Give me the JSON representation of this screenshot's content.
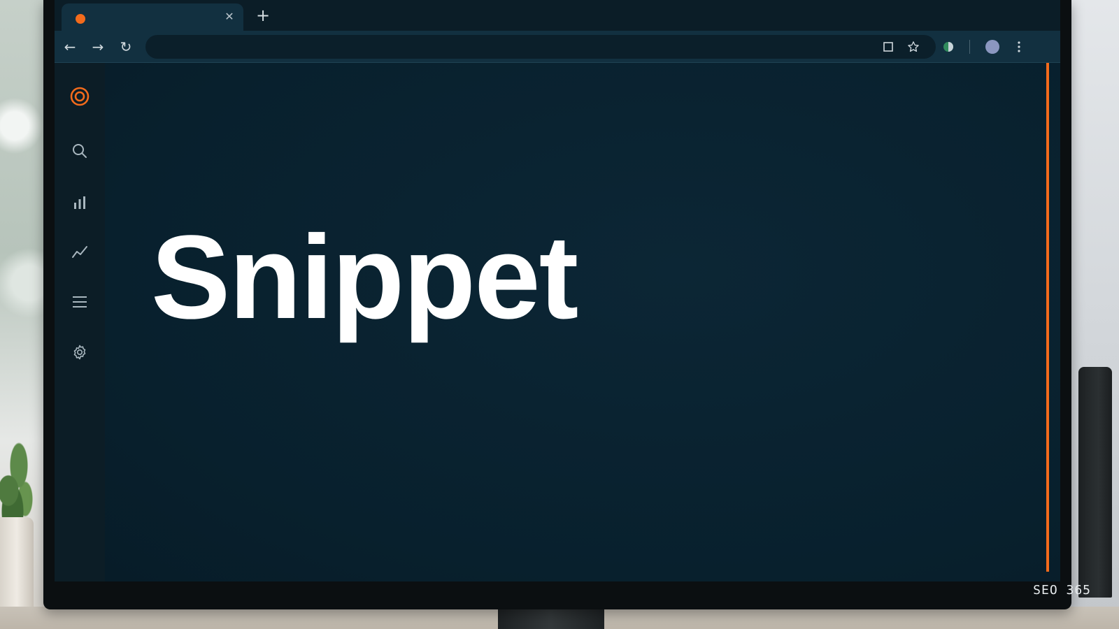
{
  "browser": {
    "tab": {
      "title": "",
      "favicon": "orange-dot-icon",
      "close_icon": "close-icon"
    },
    "new_tab_icon": "plus-icon",
    "nav": {
      "back_icon": "arrow-left-icon",
      "forward_icon": "arrow-right-icon",
      "reload_icon": "reload-icon"
    },
    "omnibox": {
      "value": "",
      "placeholder": ""
    },
    "toolbar_icons": [
      "square-icon",
      "star-icon",
      "extension-icon",
      "profile-avatar-icon",
      "kebab-menu-icon"
    ]
  },
  "sidebar": {
    "items": [
      {
        "icon": "target-logo-icon"
      },
      {
        "icon": "search-icon"
      },
      {
        "icon": "bar-chart-icon"
      },
      {
        "icon": "trend-line-icon"
      },
      {
        "icon": "menu-icon"
      },
      {
        "icon": "gear-icon"
      }
    ]
  },
  "main": {
    "title": "Snippet"
  },
  "watermark": "SEO 365",
  "colors": {
    "accent": "#f36b1c",
    "background": "#0a2230",
    "sidebar": "#0c1d26",
    "toolbar": "#123040"
  }
}
